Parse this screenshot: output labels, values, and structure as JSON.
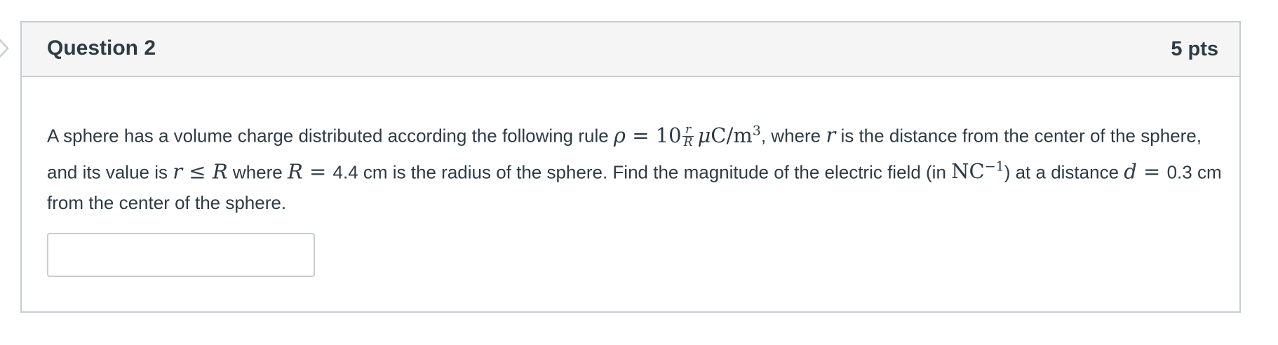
{
  "question": {
    "title": "Question 2",
    "points": "5 pts",
    "text": {
      "p1": "A sphere has a volume charge distributed according the following rule ",
      "rho": "ρ",
      "eq1": " = 10",
      "frac_num": "r",
      "frac_den": "R",
      "unit_mu": "μ",
      "unit_rest": "C/m",
      "unit_exp": "3",
      "p2": ", where ",
      "r1": "r",
      "p3": " is the distance from the center of the sphere, and its value is ",
      "r2": "r",
      "le": " ≤ ",
      "R1": "R",
      "p4": " where ",
      "R2": "R",
      "eq2": " = ",
      "p5": "4.4 cm is the radius of the sphere. Find the magnitude of the electric field (in ",
      "unit_nc": "NC",
      "unit_nc_exp": "−1",
      "p6": ") at a distance ",
      "d": "d",
      "eq3": " = ",
      "p7": "0.3 cm from the center of the sphere."
    },
    "answer": {
      "value": "",
      "placeholder": ""
    }
  },
  "colors": {
    "header_bg": "#f5f5f5",
    "border": "#c7cdd1",
    "text": "#2d3b45"
  }
}
